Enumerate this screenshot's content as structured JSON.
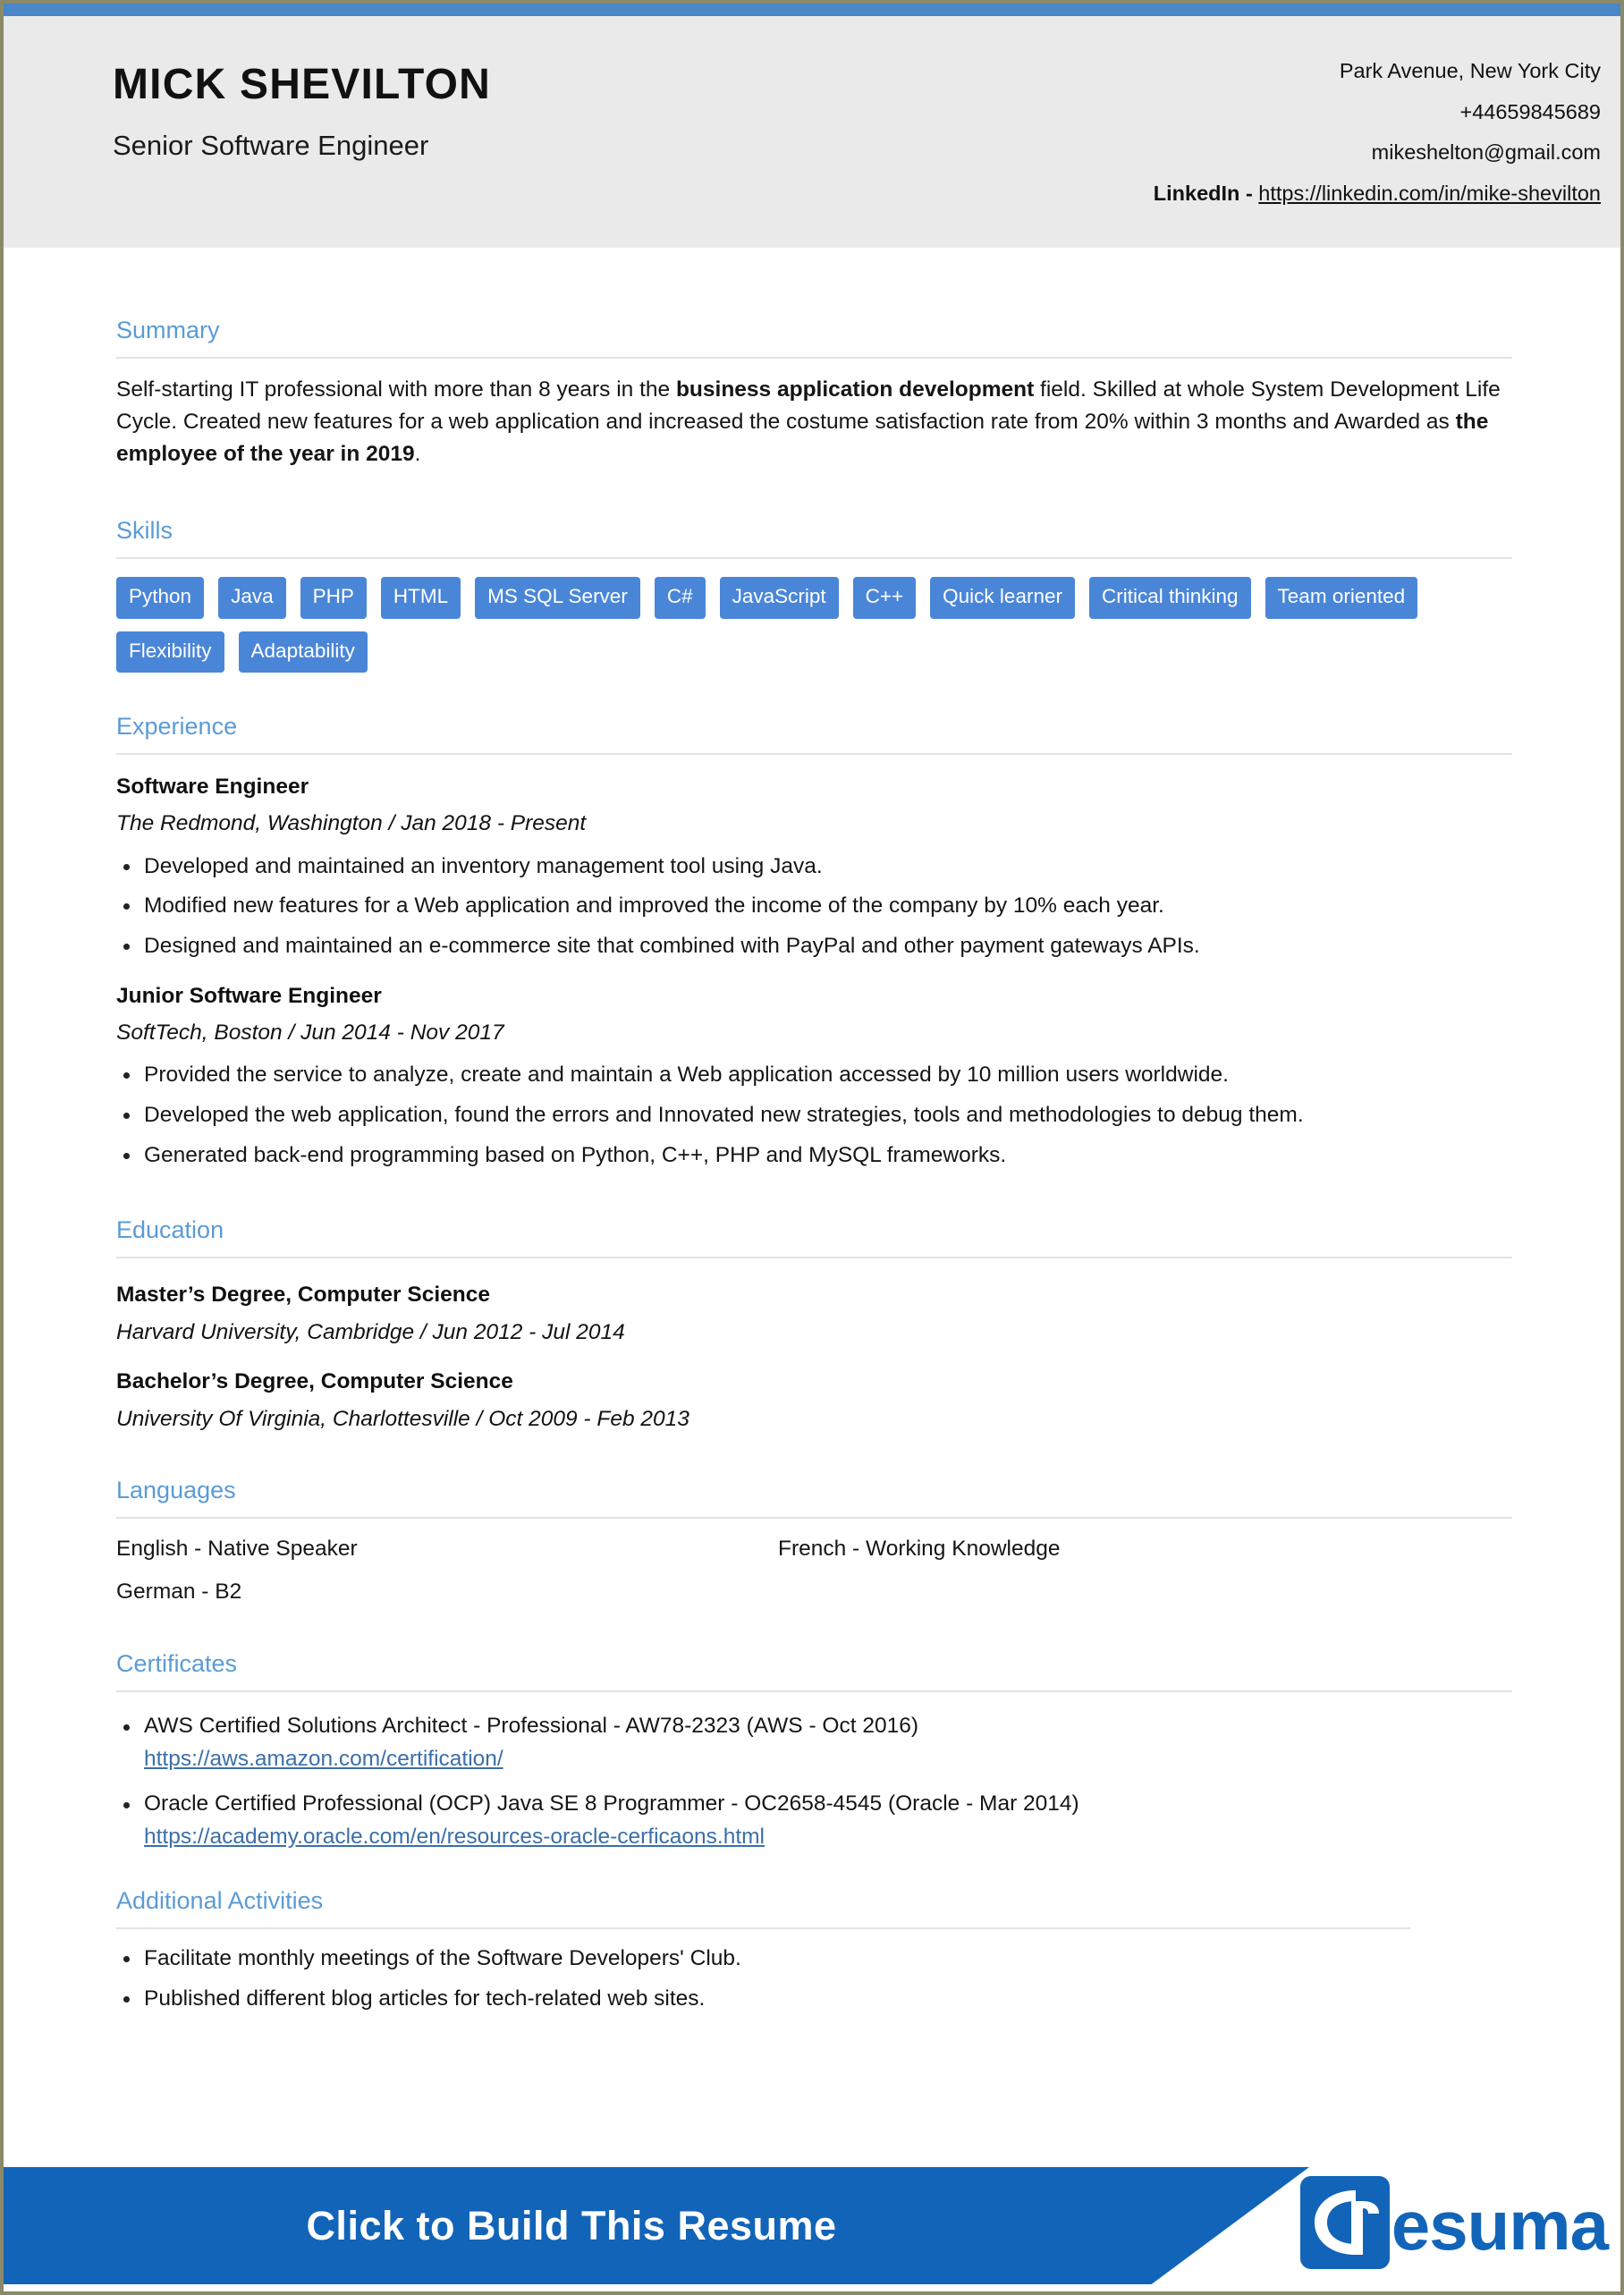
{
  "header": {
    "full_name": "MICK SHEVILTON",
    "job_title": "Senior Software Engineer",
    "address": "Park Avenue, New York City",
    "phone": "+44659845689",
    "email": "mikeshelton@gmail.com",
    "linkedin_label": "LinkedIn - ",
    "linkedin_url": "https://linkedin.com/in/mike-shevilton"
  },
  "sections": {
    "summary_title": "Summary",
    "skills_title": "Skills",
    "experience_title": "Experience",
    "education_title": "Education",
    "languages_title": "Languages",
    "certificates_title": "Certificates",
    "activities_title": "Additional Activities"
  },
  "summary": {
    "part1": "Self-starting IT professional with more than 8 years in the ",
    "bold1": "business application development",
    "part2": " field. Skilled at whole System Development Life Cycle. Created new features for a web application and increased the costume satisfaction rate from 20% within 3 months and Awarded as ",
    "bold2": "the employee of the year in 2019",
    "part3": "."
  },
  "skills": [
    "Python",
    "Java",
    "PHP",
    "HTML",
    "MS SQL Server",
    "C#",
    "JavaScript",
    "C++",
    "Quick learner",
    "Critical thinking",
    "Team oriented",
    "Flexibility",
    "Adaptability"
  ],
  "experience": [
    {
      "role": "Software Engineer",
      "meta": "The Redmond, Washington / Jan 2018 - Present",
      "bullets": [
        "Developed and maintained an inventory management tool using Java.",
        "Modified new features for a Web application and improved the income of the company by 10% each year.",
        "Designed and maintained an e-commerce site that combined with PayPal and other payment gateways APIs."
      ]
    },
    {
      "role": "Junior Software Engineer",
      "meta": "SoftTech, Boston / Jun 2014 - Nov 2017",
      "bullets": [
        "Provided the service to analyze, create and maintain a Web application accessed by 10 million users worldwide.",
        "Developed the web application, found the errors and Innovated new strategies, tools and methodologies to debug them.",
        "Generated back-end programming based on Python, C++, PHP and MySQL frameworks."
      ]
    }
  ],
  "education": [
    {
      "degree": "Master’s Degree, Computer Science",
      "meta": "Harvard University, Cambridge / Jun 2012 - Jul 2014"
    },
    {
      "degree": "Bachelor’s Degree, Computer Science",
      "meta": "University Of Virginia, Charlottesville / Oct 2009 - Feb 2013"
    }
  ],
  "languages": [
    "English - Native Speaker",
    "French - Working Knowledge",
    "German - B2"
  ],
  "certificates": [
    {
      "title": "AWS Certified Solutions Architect - Professional - AW78-2323  (AWS  -  Oct 2016)",
      "url": "https://aws.amazon.com/certification/"
    },
    {
      "title": "Oracle Certified Professional (OCP) Java SE 8 Programmer - OC2658-4545  (Oracle  -  Mar 2014)",
      "url": "https://academy.oracle.com/en/resources-oracle-cerficaons.html"
    }
  ],
  "activities": [
    "Facilitate monthly meetings of the Software Developers' Club.",
    "Published different blog articles for tech-related web sites."
  ],
  "footer": {
    "cta_label": "Click to Build This Resume",
    "brand_mark": "CR",
    "brand_word": "esuma"
  },
  "colors": {
    "accent_blue": "#5b9bd5",
    "chip_blue": "#4a86d8",
    "brand_blue": "#1264b8",
    "header_grey": "#eaeaea"
  }
}
